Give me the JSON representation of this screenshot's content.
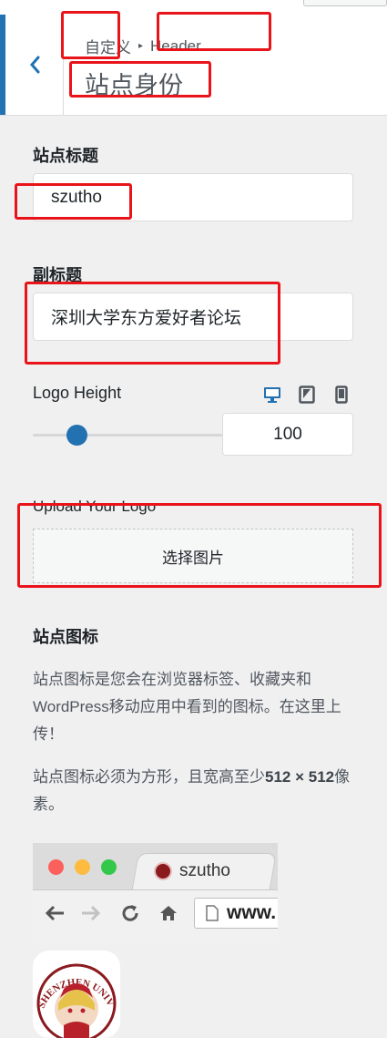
{
  "header": {
    "breadcrumb_root": "自定义",
    "breadcrumb_sep": "▸",
    "breadcrumb_section": "Header",
    "panel_title": "站点身份"
  },
  "site_title": {
    "label": "站点标题",
    "value": "szutho"
  },
  "tagline": {
    "label": "副标题",
    "value": "深圳大学东方爱好者论坛"
  },
  "logo_height": {
    "label": "Logo Height",
    "value": "100",
    "slider_level": 100,
    "devices": [
      "desktop-icon",
      "tablet-icon",
      "mobile-icon"
    ],
    "active_device": "desktop"
  },
  "upload_logo": {
    "label": "Upload Your Logo",
    "button": "选择图片"
  },
  "site_icon": {
    "label": "站点图标",
    "desc1": "站点图标是您会在浏览器标签、收藏夹和WordPress移动应用中看到的图标。在这里上传！",
    "desc2_prefix": "站点图标必须为方形，且宽高至少",
    "desc2_size": "512 × 512",
    "desc2_suffix": "像素。"
  },
  "browser_preview": {
    "tab_title": "szutho",
    "url": "www."
  },
  "logo_seal_text": "SHENZHEN UNIVERSITY",
  "colors": {
    "accent": "#2271b1",
    "highlight": "#e8141a",
    "background": "#f0f0f1"
  }
}
